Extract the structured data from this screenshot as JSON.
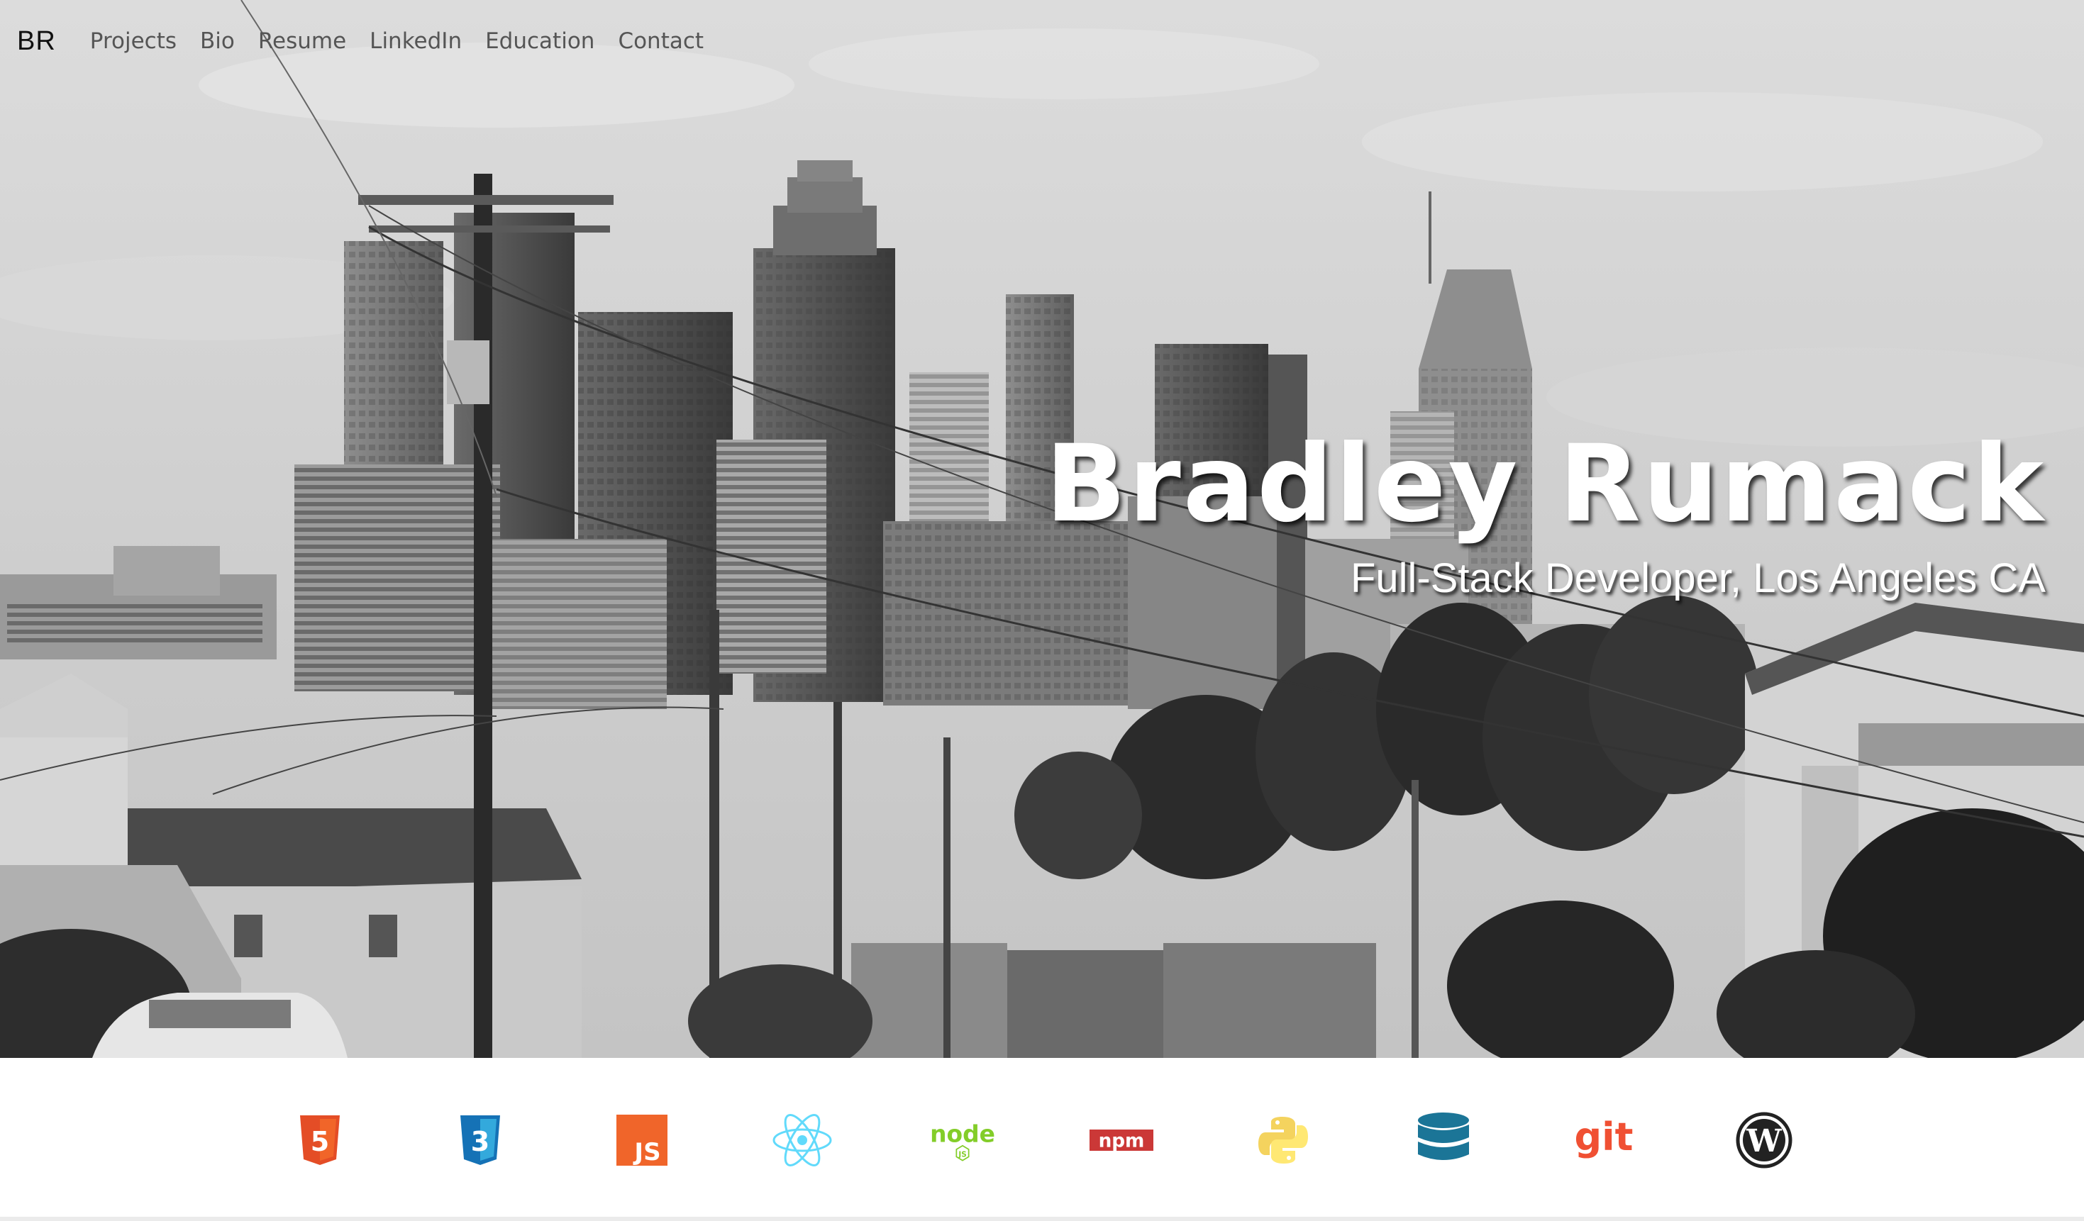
{
  "nav": {
    "brand": "BR",
    "links": [
      {
        "label": "Projects"
      },
      {
        "label": "Bio"
      },
      {
        "label": "Resume"
      },
      {
        "label": "LinkedIn"
      },
      {
        "label": "Education"
      },
      {
        "label": "Contact"
      }
    ]
  },
  "hero": {
    "title": "Bradley Rumack",
    "subtitle": "Full-Stack Developer, Los Angeles CA",
    "background": "black-and-white Los Angeles skyline photo"
  },
  "tech": {
    "icons": [
      {
        "name": "html5-icon",
        "badge": "5",
        "color": "#e44d26"
      },
      {
        "name": "css3-icon",
        "badge": "3",
        "color": "#1572b6"
      },
      {
        "name": "javascript-icon",
        "badge": "JS",
        "color": "#f0652a"
      },
      {
        "name": "react-icon",
        "color": "#61dafb"
      },
      {
        "name": "nodejs-icon",
        "badge": "node",
        "color": "#83cd29"
      },
      {
        "name": "npm-icon",
        "badge": "npm",
        "color": "#cb3837"
      },
      {
        "name": "python-icon",
        "color": "#ffd845"
      },
      {
        "name": "database-icon",
        "color": "#1b7597"
      },
      {
        "name": "git-icon",
        "badge": "git",
        "color": "#f05033"
      },
      {
        "name": "wordpress-icon",
        "color": "#222222"
      }
    ]
  }
}
